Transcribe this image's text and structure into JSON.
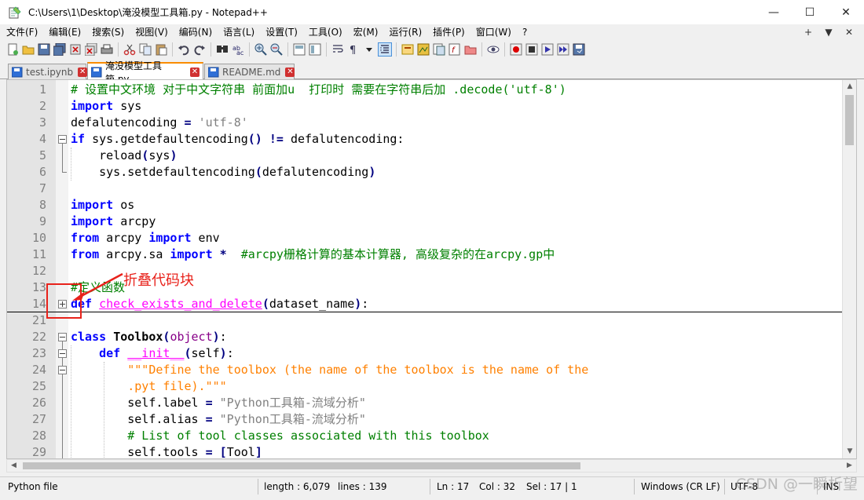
{
  "window": {
    "title": "C:\\Users\\1\\Desktop\\淹没模型工具箱.py - Notepad++",
    "controls": [
      "—",
      "☐",
      "✕"
    ]
  },
  "menu": {
    "items": [
      "文件(F)",
      "编辑(E)",
      "搜索(S)",
      "视图(V)",
      "编码(N)",
      "语言(L)",
      "设置(T)",
      "工具(O)",
      "宏(M)",
      "运行(R)",
      "插件(P)",
      "窗口(W)",
      "?"
    ],
    "right": [
      "+",
      "▼",
      "✕"
    ]
  },
  "tabs": [
    {
      "label": "test.ipynb",
      "active": false,
      "icon": "file-blue-icon"
    },
    {
      "label": "淹没模型工具箱.py",
      "active": true,
      "icon": "file-disk-icon"
    },
    {
      "label": "README.md",
      "active": false,
      "icon": "file-blue-icon"
    }
  ],
  "editor": {
    "line_numbers": [
      "1",
      "2",
      "3",
      "4",
      "5",
      "6",
      "7",
      "8",
      "9",
      "10",
      "11",
      "12",
      "13",
      "14",
      "21",
      "22",
      "23",
      "24",
      "25",
      "26",
      "27",
      "28",
      "29"
    ],
    "lines": [
      [
        {
          "c": "cm",
          "t": "# 设置中文环境 对于中文字符串 前面加u  打印时 需要在字符串后加 .decode('utf-8')"
        }
      ],
      [
        {
          "c": "kw",
          "t": "import"
        },
        {
          "c": "std",
          "t": " sys"
        }
      ],
      [
        {
          "c": "std",
          "t": "defalutencoding "
        },
        {
          "c": "op",
          "t": "="
        },
        {
          "c": "std",
          "t": " "
        },
        {
          "c": "st",
          "t": "'utf-8'"
        }
      ],
      [
        {
          "c": "kw",
          "t": "if"
        },
        {
          "c": "std",
          "t": " sys.getdefaultencoding"
        },
        {
          "c": "op",
          "t": "()"
        },
        {
          "c": "std",
          "t": " "
        },
        {
          "c": "op",
          "t": "!="
        },
        {
          "c": "std",
          "t": " defalutencoding:"
        }
      ],
      [
        {
          "c": "std",
          "t": "    reload"
        },
        {
          "c": "op",
          "t": "("
        },
        {
          "c": "std",
          "t": "sys"
        },
        {
          "c": "op",
          "t": ")"
        }
      ],
      [
        {
          "c": "std",
          "t": "    sys.setdefaultencoding"
        },
        {
          "c": "op",
          "t": "("
        },
        {
          "c": "std",
          "t": "defalutencoding"
        },
        {
          "c": "op",
          "t": ")"
        }
      ],
      [],
      [
        {
          "c": "kw",
          "t": "import"
        },
        {
          "c": "std",
          "t": " os"
        }
      ],
      [
        {
          "c": "kw",
          "t": "import"
        },
        {
          "c": "std",
          "t": " arcpy"
        }
      ],
      [
        {
          "c": "kw",
          "t": "from"
        },
        {
          "c": "std",
          "t": " arcpy "
        },
        {
          "c": "kw",
          "t": "import"
        },
        {
          "c": "std",
          "t": " env"
        }
      ],
      [
        {
          "c": "kw",
          "t": "from"
        },
        {
          "c": "std",
          "t": " arcpy.sa "
        },
        {
          "c": "kw",
          "t": "import"
        },
        {
          "c": "std",
          "t": " "
        },
        {
          "c": "op",
          "t": "*"
        },
        {
          "c": "std",
          "t": "  "
        },
        {
          "c": "cm",
          "t": "#arcpy栅格计算的基本计算器, 高级复杂的在arcpy.gp中"
        }
      ],
      [],
      [
        {
          "c": "cm",
          "t": "#定义函数"
        }
      ],
      [
        {
          "c": "kw",
          "t": "def"
        },
        {
          "c": "std",
          "t": " "
        },
        {
          "c": "fn",
          "t": "check_exists_and_delete"
        },
        {
          "c": "op",
          "t": "("
        },
        {
          "c": "std",
          "t": "dataset_name"
        },
        {
          "c": "op",
          "t": ")"
        },
        {
          "c": "std",
          "t": ":"
        }
      ],
      [],
      [
        {
          "c": "kw",
          "t": "class"
        },
        {
          "c": "std",
          "t": " "
        },
        {
          "c": "cls",
          "t": "Toolbox"
        },
        {
          "c": "op",
          "t": "("
        },
        {
          "c": "magenta",
          "t": "object"
        },
        {
          "c": "op",
          "t": ")"
        },
        {
          "c": "std",
          "t": ":"
        }
      ],
      [
        {
          "c": "std",
          "t": "    "
        },
        {
          "c": "kw",
          "t": "def"
        },
        {
          "c": "std",
          "t": " "
        },
        {
          "c": "fn",
          "t": "__init__"
        },
        {
          "c": "op",
          "t": "("
        },
        {
          "c": "std",
          "t": "self"
        },
        {
          "c": "op",
          "t": ")"
        },
        {
          "c": "std",
          "t": ":"
        }
      ],
      [
        {
          "c": "std",
          "t": "        "
        },
        {
          "c": "doc",
          "t": "\"\"\"Define the toolbox (the name of the toolbox is the name of the"
        }
      ],
      [
        {
          "c": "std",
          "t": "        "
        },
        {
          "c": "doc",
          "t": ".pyt file).\"\"\""
        }
      ],
      [
        {
          "c": "std",
          "t": "        self.label "
        },
        {
          "c": "op",
          "t": "="
        },
        {
          "c": "std",
          "t": " "
        },
        {
          "c": "st",
          "t": "\"Python工具箱-流域分析\""
        }
      ],
      [
        {
          "c": "std",
          "t": "        self.alias "
        },
        {
          "c": "op",
          "t": "="
        },
        {
          "c": "std",
          "t": " "
        },
        {
          "c": "st",
          "t": "\"Python工具箱-流域分析\""
        }
      ],
      [
        {
          "c": "std",
          "t": "        "
        },
        {
          "c": "cm",
          "t": "# List of tool classes associated with this toolbox"
        }
      ],
      [
        {
          "c": "std",
          "t": "        self.tools "
        },
        {
          "c": "op",
          "t": "="
        },
        {
          "c": "std",
          "t": " "
        },
        {
          "c": "op",
          "t": "["
        },
        {
          "c": "std",
          "t": "Tool"
        },
        {
          "c": "op",
          "t": "]"
        }
      ]
    ]
  },
  "annotation": {
    "text": "折叠代码块"
  },
  "statusbar": {
    "language": "Python file",
    "length": "length : 6,079",
    "lines": "lines : 139",
    "ln": "Ln : 17",
    "col": "Col : 32",
    "sel": "Sel : 17 | 1",
    "eol": "Windows (CR LF)",
    "encoding": "UTF-8",
    "mode": "INS"
  },
  "watermark": "CSDN @一瞬析望",
  "colors": {
    "keyword": "#0000ff",
    "comment": "#008000",
    "string": "#808080",
    "docstring": "#ff8000",
    "function": "#ff00ff",
    "annotation": "#e8221b",
    "active_tab_accent": "#fa8c00"
  }
}
